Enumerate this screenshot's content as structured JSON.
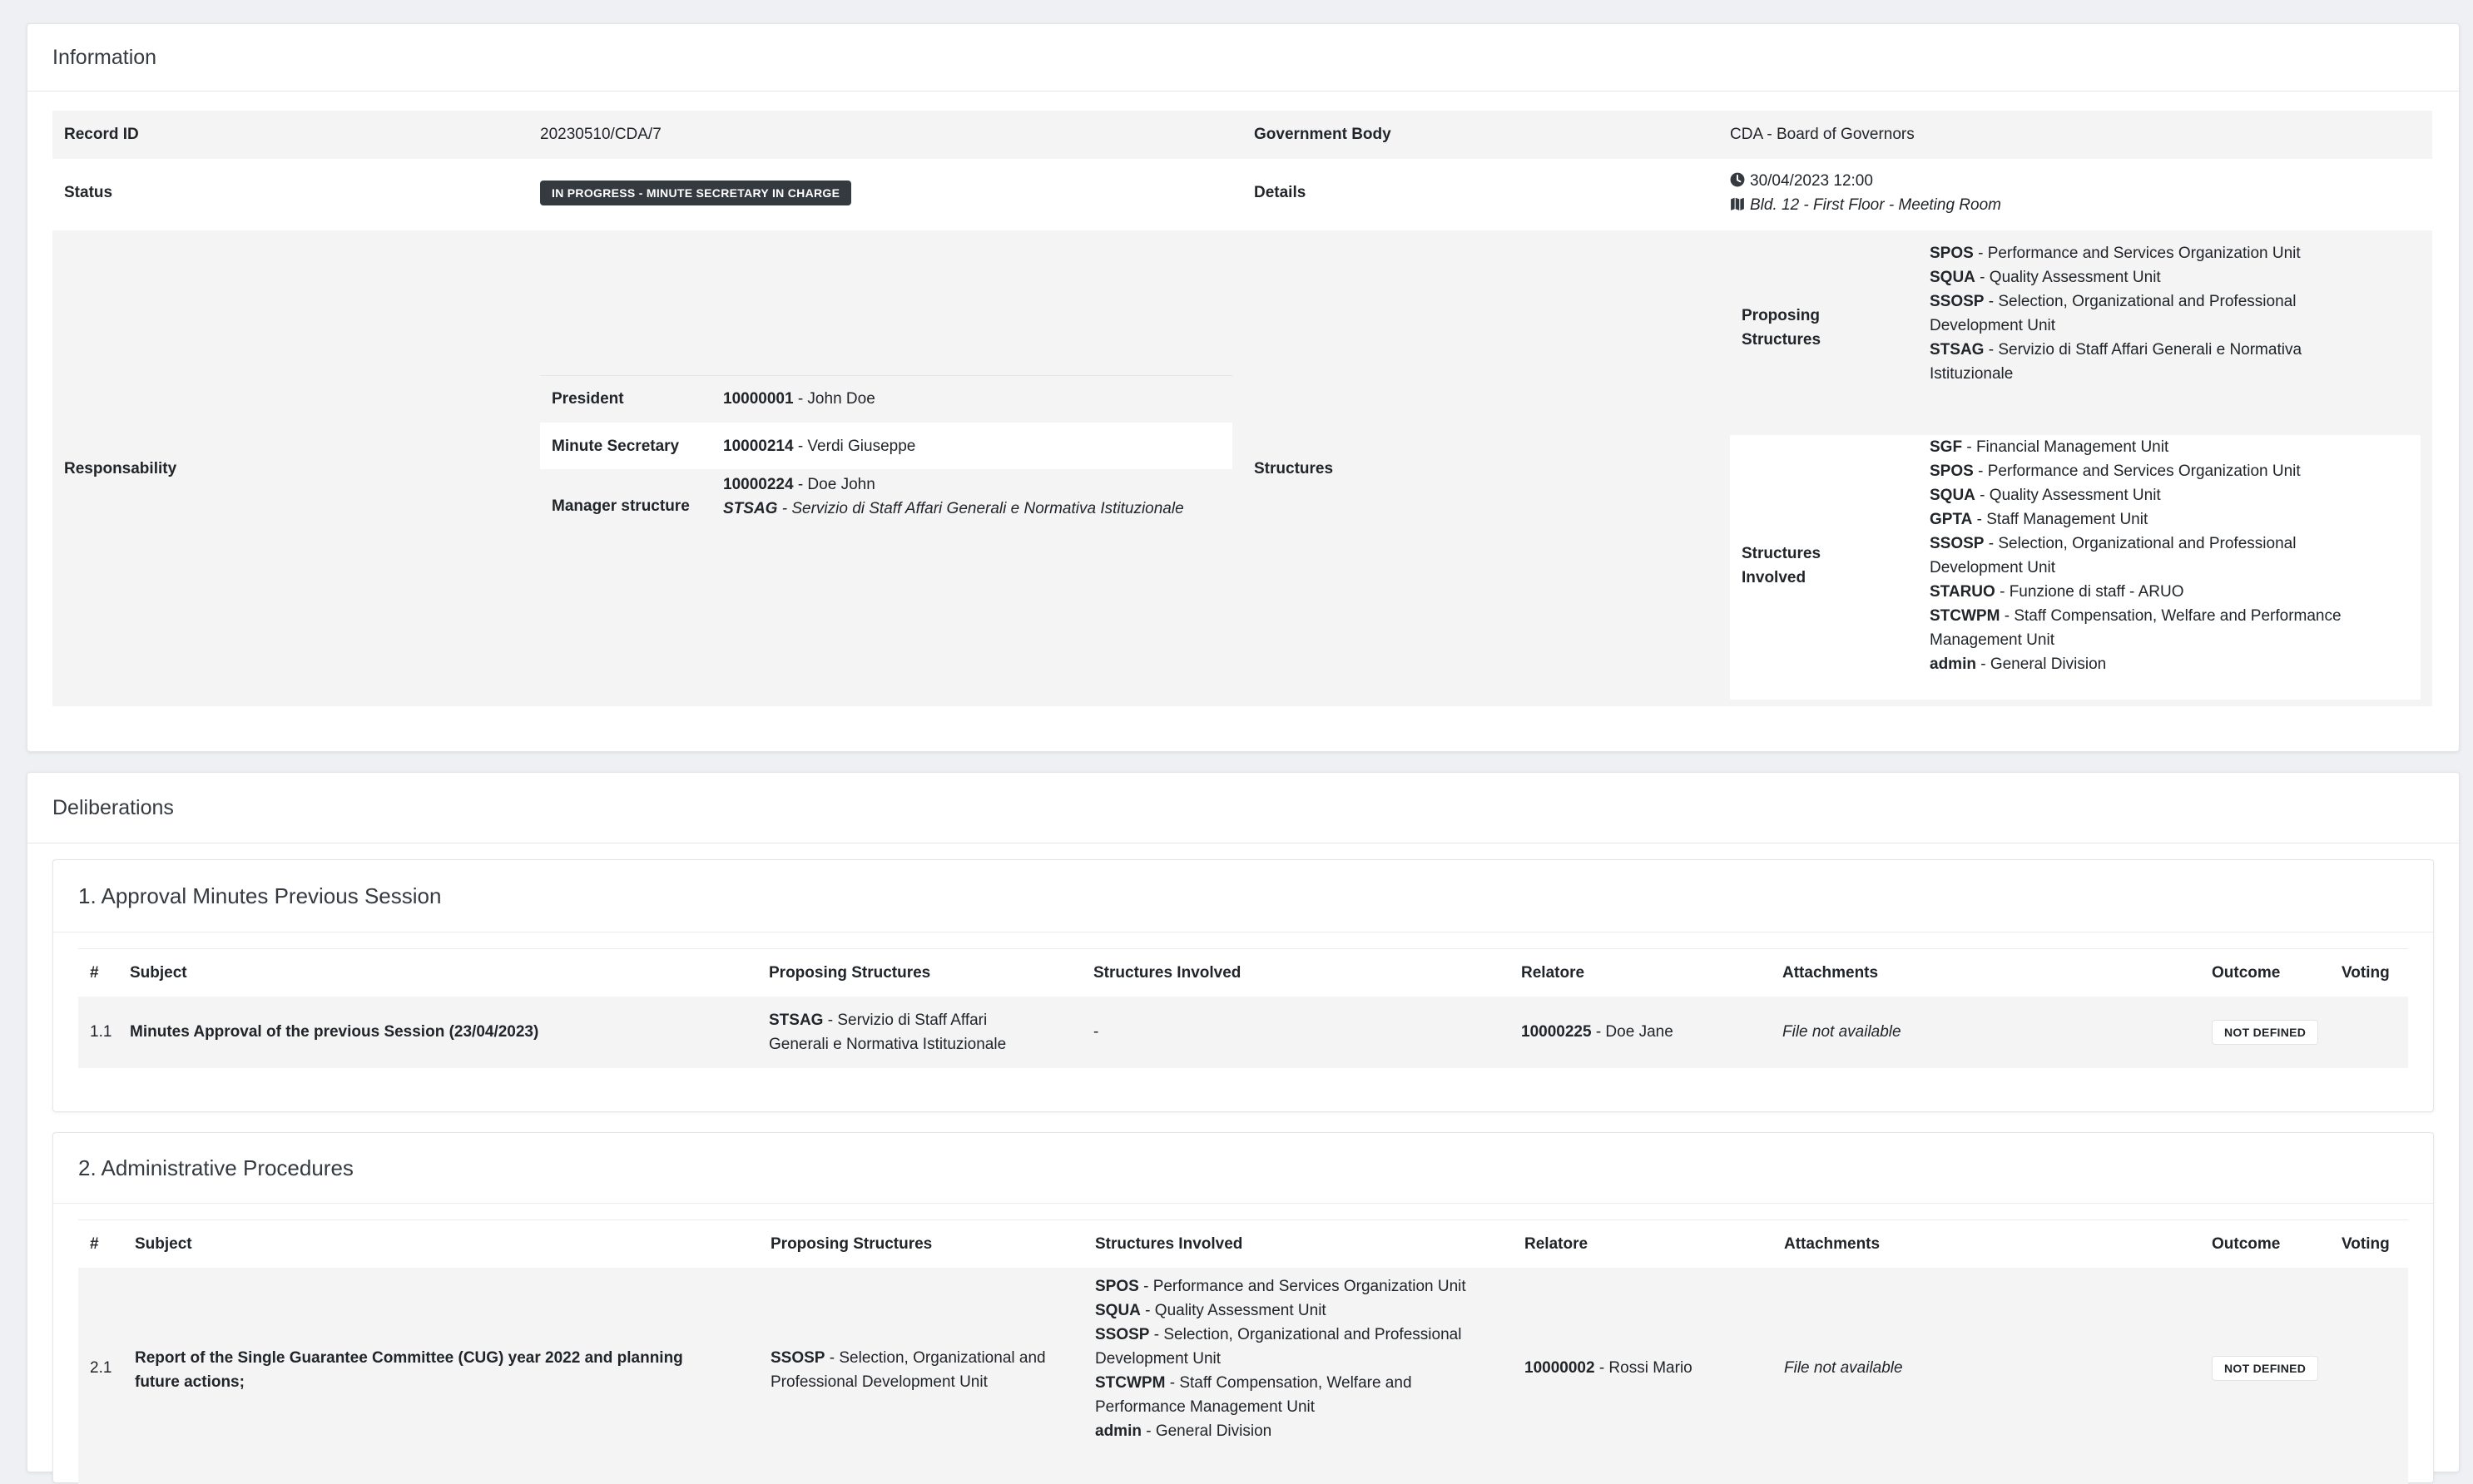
{
  "information": {
    "title": "Information",
    "record_id_label": "Record ID",
    "record_id": "20230510/CDA/7",
    "gov_body_label": "Government Body",
    "gov_body": "CDA - Board of Governors",
    "status_label": "Status",
    "status": "IN PROGRESS - MINUTE SECRETARY IN CHARGE",
    "details_label": "Details",
    "details_datetime": "30/04/2023 12:00",
    "details_location": "Bld. 12 - First Floor - Meeting Room",
    "responsability_label": "Responsability",
    "president_label": "President",
    "president_code": "10000001",
    "president_name": " - John Doe",
    "secretary_label": "Minute Secretary",
    "secretary_code": "10000214",
    "secretary_name": " - Verdi Giuseppe",
    "manager_label": "Manager structure",
    "manager_code": "10000224",
    "manager_name": " - Doe John",
    "manager_struct_code": "STSAG",
    "manager_struct_name": " - Servizio di Staff Affari Generali e Normativa Istituzionale",
    "structures_label": "Structures",
    "proposing_label_1": "Proposing",
    "proposing_label_2": "Structures",
    "proposing": [
      {
        "code": "SPOS",
        "lines": [
          " - Performance and Services Organization Unit"
        ]
      },
      {
        "code": "SQUA",
        "lines": [
          " - Quality Assessment Unit"
        ]
      },
      {
        "code": "SSOSP",
        "lines": [
          " - Selection, Organizational and Professional",
          "Development Unit"
        ]
      },
      {
        "code": "STSAG",
        "lines": [
          " - Servizio di Staff Affari Generali e Normativa",
          "Istituzionale"
        ]
      }
    ],
    "involved_label_1": "Structures",
    "involved_label_2": "Involved",
    "involved": [
      {
        "code": "SGF",
        "lines": [
          " - Financial Management Unit"
        ]
      },
      {
        "code": "SPOS",
        "lines": [
          " - Performance and Services Organization Unit"
        ]
      },
      {
        "code": "SQUA",
        "lines": [
          " - Quality Assessment Unit"
        ]
      },
      {
        "code": "GPTA",
        "lines": [
          " - Staff Management Unit"
        ]
      },
      {
        "code": "SSOSP",
        "lines": [
          " - Selection, Organizational and Professional",
          "Development Unit"
        ]
      },
      {
        "code": "STARUO",
        "lines": [
          " - Funzione di staff - ARUO"
        ]
      },
      {
        "code": "STCWPM",
        "lines": [
          " - Staff Compensation, Welfare and Performance",
          "Management Unit"
        ]
      },
      {
        "code": "admin",
        "lines": [
          " - General Division"
        ]
      }
    ]
  },
  "deliberations": {
    "title": "Deliberations",
    "columns": {
      "num": "#",
      "subject": "Subject",
      "proposing": "Proposing Structures",
      "involved": "Structures Involved",
      "relatore": "Relatore",
      "attachments": "Attachments",
      "outcome": "Outcome",
      "voting": "Voting"
    },
    "sections": [
      {
        "title": "1. Approval Minutes Previous Session",
        "row": {
          "num": "1.1",
          "subject": "Minutes Approval of the previous Session (23/04/2023)",
          "proposing_code": "STSAG",
          "proposing_l1": " - Servizio di Staff Affari",
          "proposing_l2": "Generali e Normativa Istituzionale",
          "involved": "-",
          "relatore_code": "10000225",
          "relatore_name": " - Doe Jane",
          "attachments": "File not available",
          "outcome": "NOT DEFINED"
        }
      },
      {
        "title": "2. Administrative Procedures",
        "row": {
          "num": "2.1",
          "subject_l1": "Report of the Single Guarantee Committee (CUG) year 2022 and planning",
          "subject_l2": "future actions;",
          "proposing_code": "SSOSP",
          "proposing_l1": " - Selection, Organizational and",
          "proposing_l2": "Professional Development Unit",
          "involved": [
            {
              "code": "SPOS",
              "lines": [
                " - Performance and Services Organization Unit"
              ]
            },
            {
              "code": "SQUA",
              "lines": [
                " - Quality Assessment Unit"
              ]
            },
            {
              "code": "SSOSP",
              "lines": [
                " - Selection, Organizational and Professional",
                "Development Unit"
              ]
            },
            {
              "code": "STCWPM",
              "lines": [
                " - Staff Compensation, Welfare and",
                "Performance Management Unit"
              ]
            },
            {
              "code": "admin",
              "lines": [
                " - General Division"
              ]
            }
          ],
          "relatore_code": "10000002",
          "relatore_name": " - Rossi Mario",
          "attachments": "File not available",
          "outcome": "NOT DEFINED"
        }
      }
    ]
  }
}
